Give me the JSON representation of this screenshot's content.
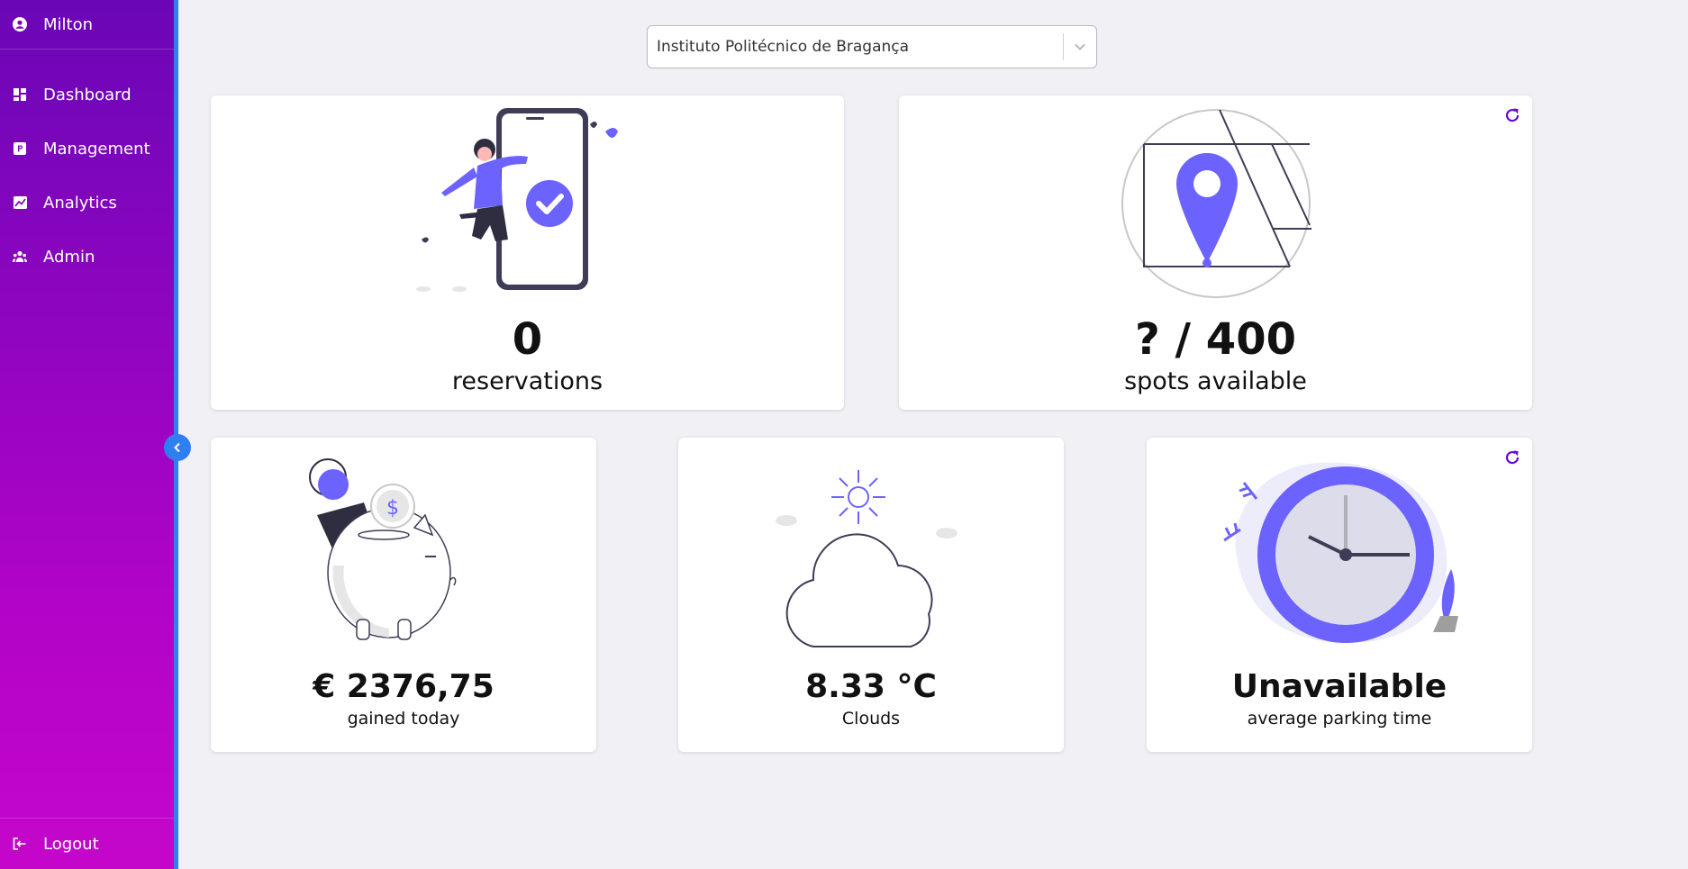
{
  "sidebar": {
    "user": {
      "name": "Milton",
      "icon": "user-circle-icon"
    },
    "items": [
      {
        "label": "Dashboard",
        "icon": "dashboard-icon"
      },
      {
        "label": "Management",
        "icon": "parking-icon"
      },
      {
        "label": "Analytics",
        "icon": "chart-icon"
      },
      {
        "label": "Admin",
        "icon": "users-icon"
      }
    ],
    "logout": {
      "label": "Logout",
      "icon": "logout-icon"
    }
  },
  "location_select": {
    "value": "Instituto Politécnico de Bragança"
  },
  "cards": {
    "reservations": {
      "value": "0",
      "label": "reservations"
    },
    "spots": {
      "value": "? / 400",
      "label": "spots available"
    },
    "earnings": {
      "value": "€ 2376,75",
      "label": "gained today"
    },
    "weather": {
      "value": "8.33 °C",
      "label": "Clouds"
    },
    "parking_time": {
      "value": "Unavailable",
      "label": "average parking time"
    }
  },
  "colors": {
    "accent": "#6c63ff",
    "sidebar_top": "#6a06b6",
    "sidebar_bottom": "#c406ca",
    "collapse": "#2f7ff0"
  }
}
